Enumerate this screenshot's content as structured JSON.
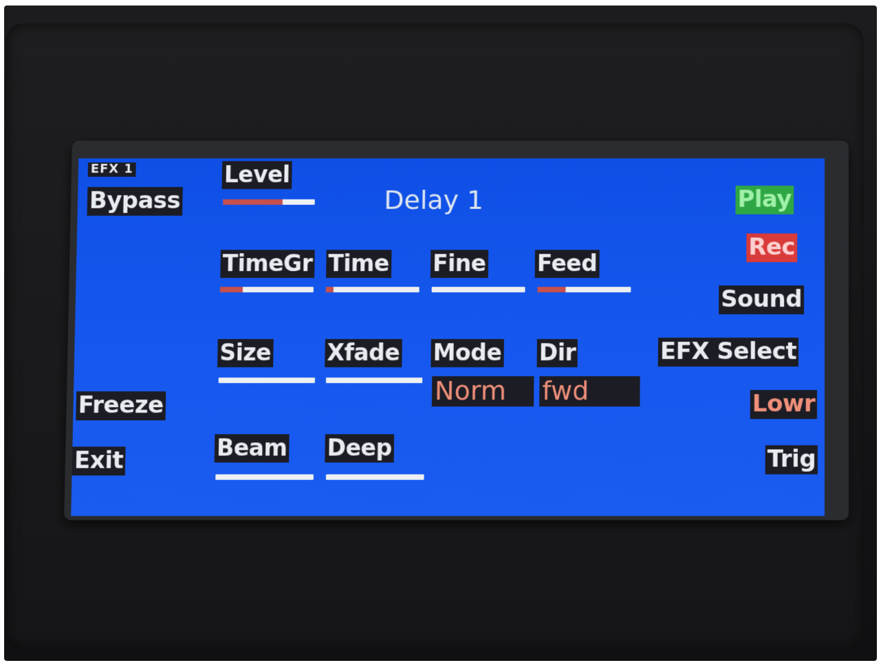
{
  "screen": {
    "efx_label": "EFX 1",
    "title": "Delay 1",
    "colors": {
      "background": "#1253e6",
      "label_bg": "#1c1c24",
      "label_text": "#e8ecf0",
      "bar_fill": "#c6504e",
      "value_text": "#f0907a",
      "play": "#2fa644",
      "rec": "#d93a3a"
    }
  },
  "left_buttons": {
    "bypass": "Bypass",
    "freeze": "Freeze",
    "exit": "Exit"
  },
  "right_buttons": {
    "play": "Play",
    "rec": "Rec",
    "sound": "Sound",
    "efx_select": "EFX Select",
    "lowr": "Lowr",
    "trig": "Trig"
  },
  "params": {
    "level": {
      "label": "Level",
      "value_fraction": 0.65
    },
    "timegr": {
      "label": "TimeGr",
      "value_fraction": 0.24
    },
    "time": {
      "label": "Time",
      "value_fraction": 0.08
    },
    "fine": {
      "label": "Fine",
      "value_fraction": 0.0
    },
    "feed": {
      "label": "Feed",
      "value_fraction": 0.3
    },
    "size": {
      "label": "Size",
      "value_fraction": 0.0
    },
    "xfade": {
      "label": "Xfade",
      "value_fraction": 0.0
    },
    "mode": {
      "label": "Mode",
      "value": "Norm"
    },
    "dir": {
      "label": "Dir",
      "value": "fwd"
    },
    "beam": {
      "label": "Beam",
      "value_fraction": 0.0
    },
    "deep": {
      "label": "Deep",
      "value_fraction": 0.0
    }
  }
}
